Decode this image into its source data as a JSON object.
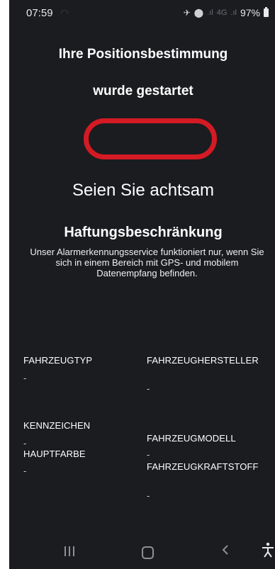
{
  "status_bar": {
    "time": "07:59",
    "network_type": "4G",
    "battery": "97%",
    "icons": [
      "notification-icon",
      "wifi-calling-icon",
      "location-icon",
      "signal-icon",
      "signal-icon",
      "battery-icon"
    ]
  },
  "heading": {
    "line1": "Ihre Positionsbestimmung",
    "line2": "wurde gestartet"
  },
  "alert": "Seien Sie achtsam",
  "liability": {
    "title": "Haftungsbeschränkung",
    "text": "Unser Alarmerkennungsservice funktioniert nur, wenn Sie sich in einem Bereich mit GPS- und mobilem Datenempfang befinden."
  },
  "vehicle": {
    "type_label": "FAHRZEUGTYP",
    "type_value": "-",
    "manufacturer_label": "FAHRZEUGHERSTELLER",
    "manufacturer_value": "-",
    "plate_label": "KENNZEICHEN",
    "plate_value": "-",
    "model_label": "FAHRZEUGMODELL",
    "model_value": "-",
    "color_label": "HAUPTFARBE",
    "color_value": "-",
    "fuel_label": "FAHRZEUGKRAFTSTOFF",
    "fuel_value": "-"
  },
  "colors": {
    "background": "#1b1c20",
    "accent_frame": "#d41a23",
    "text": "#ffffff"
  }
}
